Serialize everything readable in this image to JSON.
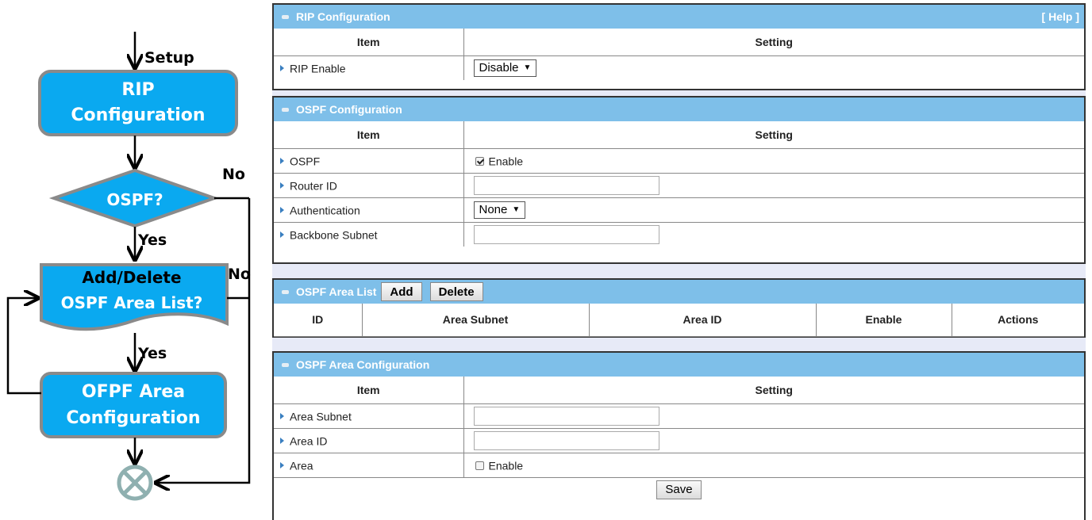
{
  "flowchart": {
    "setup_label": "Setup",
    "rip_step": [
      "RIP",
      "Configuration"
    ],
    "ospf_decision": "OSPF?",
    "decision_no": "No",
    "decision_yes": "Yes",
    "area_list_step": [
      "Add/Delete",
      "OSPF Area List?"
    ],
    "area_list_no": "No",
    "area_list_yes": "Yes",
    "area_config_step": [
      "OFPF Area",
      "Configuration"
    ]
  },
  "rip_panel": {
    "title": "RIP Configuration",
    "help": "[ Help ]",
    "col_item": "Item",
    "col_setting": "Setting",
    "rip_enable_label": "RIP Enable",
    "rip_enable_value": "Disable"
  },
  "ospf_panel": {
    "title": "OSPF Configuration",
    "col_item": "Item",
    "col_setting": "Setting",
    "ospf_label": "OSPF",
    "ospf_checkbox_label": "Enable",
    "ospf_checked": true,
    "router_id_label": "Router ID",
    "router_id_value": "",
    "auth_label": "Authentication",
    "auth_value": "None",
    "backbone_label": "Backbone Subnet",
    "backbone_value": ""
  },
  "area_list_panel": {
    "title": "OSPF Area List",
    "add_button": "Add",
    "delete_button": "Delete",
    "columns": [
      "ID",
      "Area Subnet",
      "Area ID",
      "Enable",
      "Actions"
    ]
  },
  "area_config_panel": {
    "title": "OSPF Area Configuration",
    "col_item": "Item",
    "col_setting": "Setting",
    "area_subnet_label": "Area Subnet",
    "area_subnet_value": "",
    "area_id_label": "Area ID",
    "area_id_value": "",
    "area_label": "Area",
    "area_checkbox_label": "Enable",
    "area_checked": false,
    "save_button": "Save"
  },
  "colors": {
    "header_blue": "#7ebfe9",
    "flow_box": "#0aa9f0",
    "flow_border": "#8a8a8a",
    "end_symbol": "#8fb0b0"
  },
  "icons": {
    "row_bullet": "triangle-right-icon",
    "header_bullet": "panel-bullet-icon",
    "end": "end-cross-circle-icon"
  }
}
